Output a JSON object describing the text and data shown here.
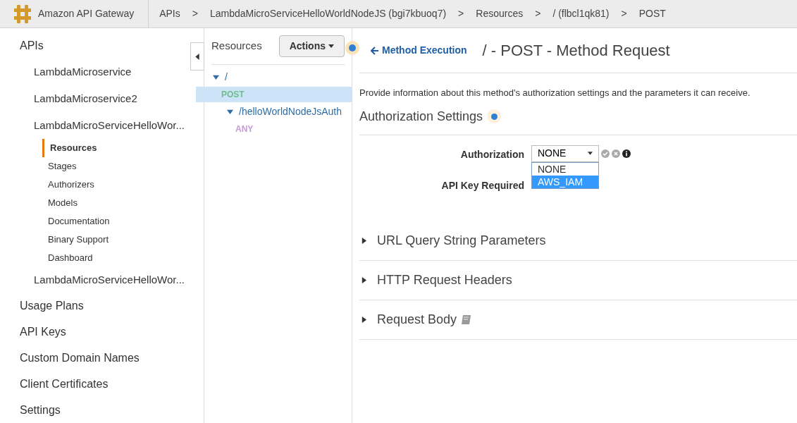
{
  "header": {
    "brand": "Amazon API Gateway",
    "breadcrumbs": [
      "APIs",
      "LambdaMicroServiceHelloWorldNodeJS (bgi7kbuoq7)",
      "Resources",
      "/ (flbcl1qk81)",
      "POST"
    ],
    "separator": ">"
  },
  "sidebar": {
    "items": [
      {
        "label": "APIs",
        "selected": false,
        "children": [
          {
            "label": "LambdaMicroservice",
            "selected": false
          },
          {
            "label": "LambdaMicroservice2",
            "selected": false
          },
          {
            "label": "LambdaMicroServiceHelloWor...",
            "selected": false,
            "children": [
              {
                "label": "Resources",
                "selected": true
              },
              {
                "label": "Stages",
                "selected": false
              },
              {
                "label": "Authorizers",
                "selected": false
              },
              {
                "label": "Models",
                "selected": false
              },
              {
                "label": "Documentation",
                "selected": false
              },
              {
                "label": "Binary Support",
                "selected": false
              },
              {
                "label": "Dashboard",
                "selected": false
              }
            ]
          },
          {
            "label": "LambdaMicroServiceHelloWor...",
            "selected": false
          }
        ]
      },
      {
        "label": "Usage Plans",
        "selected": false
      },
      {
        "label": "API Keys",
        "selected": false
      },
      {
        "label": "Custom Domain Names",
        "selected": false
      },
      {
        "label": "Client Certificates",
        "selected": false
      },
      {
        "label": "Settings",
        "selected": false
      }
    ]
  },
  "resources": {
    "title": "Resources",
    "actions_button": "Actions",
    "tree": [
      {
        "kind": "path",
        "label": "/",
        "expanded": true,
        "selected": false,
        "children": [
          {
            "kind": "method",
            "label": "POST",
            "color": "#6cbf8a",
            "selected": true
          },
          {
            "kind": "path",
            "label": "/helloWorldNodeJsAuth",
            "expanded": true,
            "selected": false,
            "children": [
              {
                "kind": "method",
                "label": "ANY",
                "color": "#c79bd6",
                "selected": false
              }
            ]
          }
        ]
      }
    ]
  },
  "content": {
    "back_link": "Method Execution",
    "title": "/ - POST - Method Request",
    "description": "Provide information about this method's authorization settings and the parameters it can receive.",
    "section_title": "Authorization Settings",
    "fields": [
      {
        "label": "Authorization",
        "value": "NONE",
        "open": true,
        "options": [
          {
            "label": "NONE",
            "highlighted": false
          },
          {
            "label": "AWS_IAM",
            "highlighted": true
          }
        ]
      },
      {
        "label": "API Key Required"
      }
    ],
    "sections": [
      {
        "title": "URL Query String Parameters",
        "expanded": false,
        "book": false
      },
      {
        "title": "HTTP Request Headers",
        "expanded": false,
        "book": false
      },
      {
        "title": "Request Body",
        "expanded": false,
        "book": true
      }
    ]
  }
}
